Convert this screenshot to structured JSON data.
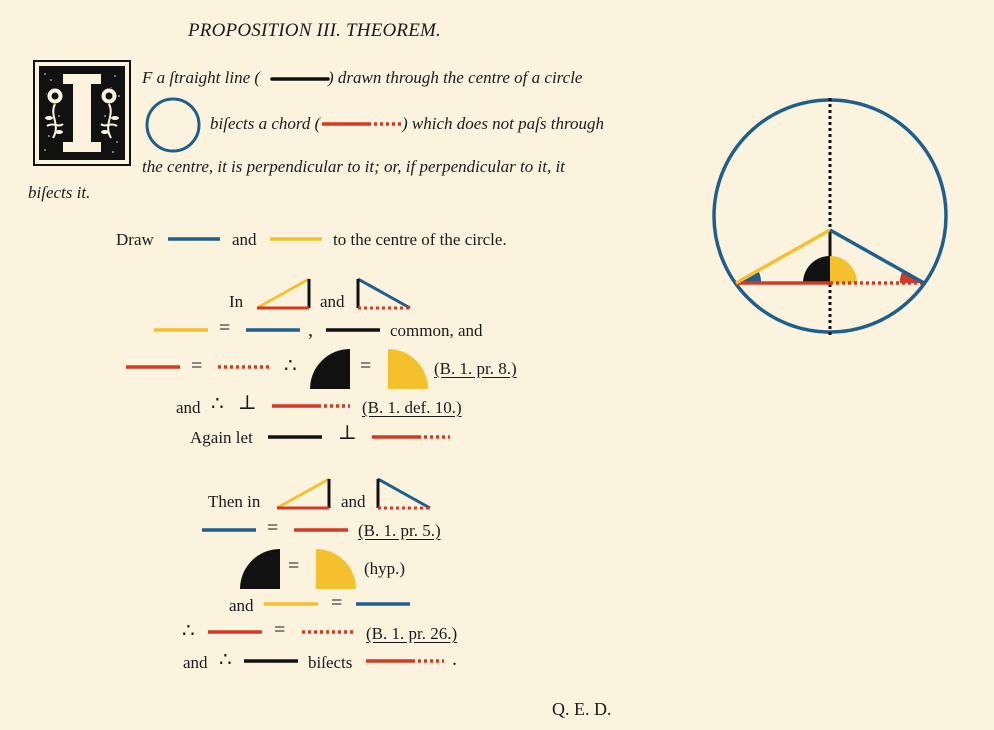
{
  "title": "PROPOSITION III. THEOREM.",
  "dropcap_letter": "I",
  "intro": {
    "line1a": "F a ſtraight line (",
    "line1b": ") drawn through the centre of a circle",
    "line2a": "biſects a chord (",
    "line2b": ") which does not paſs through",
    "line3": "the centre, it is perpendicular to it; or, if perpendicular to it, it",
    "line4": "biſects it."
  },
  "draw": {
    "word": "Draw",
    "and": "and",
    "rest": "to the centre of the circle."
  },
  "proof1": {
    "in": "In",
    "and": "and",
    "common": "common, and",
    "ref1": "(B. 1. pr. 8.)",
    "and2": "and",
    "ref2": "(B. 1. def. 10.)",
    "again": "Again let"
  },
  "proof2": {
    "then_in": "Then in",
    "and": "and",
    "ref1": "(B. 1. pr. 5.)",
    "hyp": "(hyp.)",
    "and2": "and",
    "ref2": "(B. 1. pr. 26.)",
    "and3": "and",
    "bisects": "biſects"
  },
  "qed": "Q. E. D.",
  "colors": {
    "background": "#fbf3dd",
    "black": "#111111",
    "red": "#d33a26",
    "blue": "#1f5f8c",
    "yellow": "#f5c02e"
  },
  "icons": [
    "dropcap-ornament",
    "circle-icon",
    "triangle-icon",
    "perpendicular-symbol",
    "therefore-symbol",
    "semicircle-angle-icon"
  ]
}
